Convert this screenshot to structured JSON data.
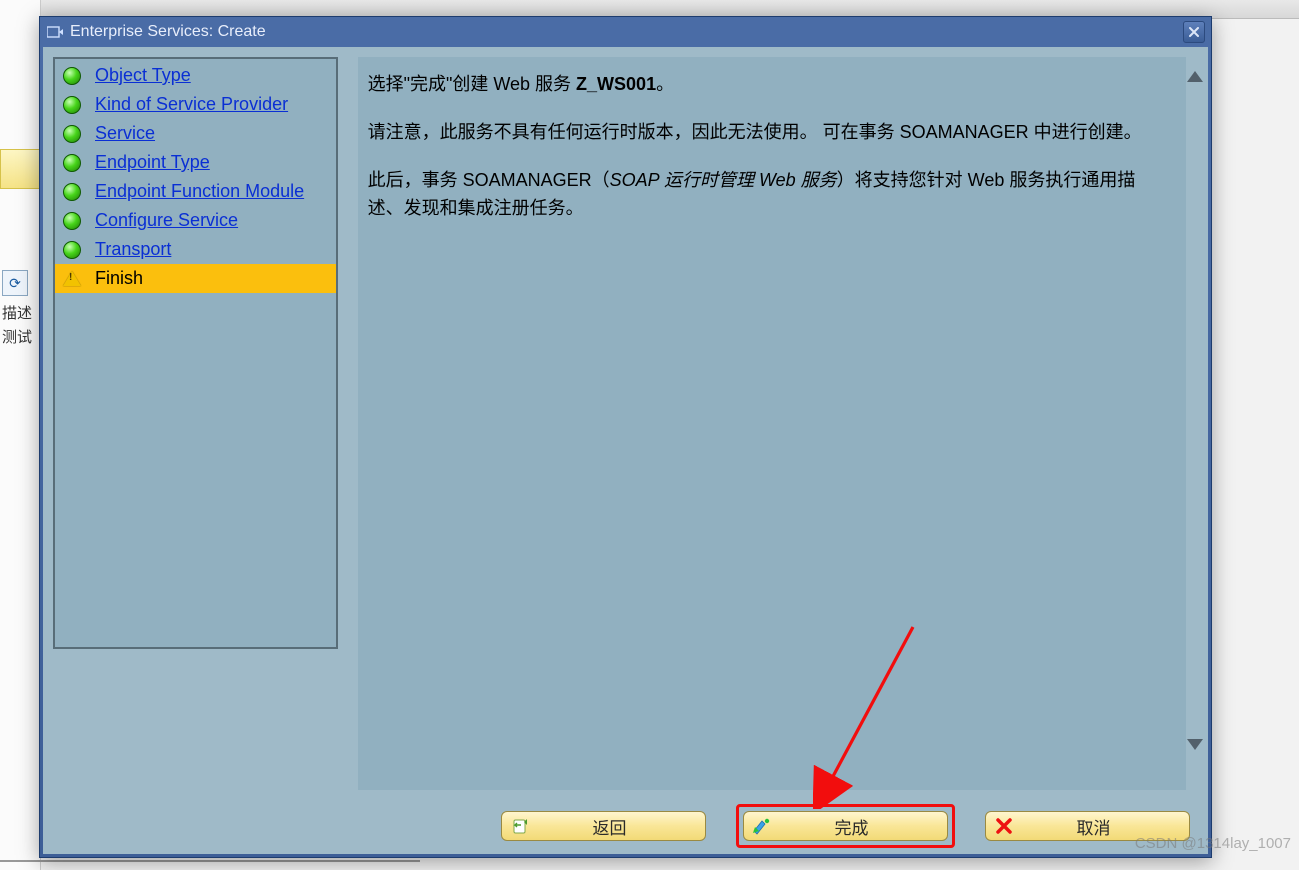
{
  "background": {
    "label1": "描述",
    "label2": "测试"
  },
  "dialog": {
    "title": "Enterprise Services: Create",
    "nav": {
      "items": [
        {
          "label": "Object Type",
          "status": "green",
          "selected": false
        },
        {
          "label": "Kind of Service Provider",
          "status": "green",
          "selected": false
        },
        {
          "label": "Service",
          "status": "green",
          "selected": false
        },
        {
          "label": "Endpoint Type",
          "status": "green",
          "selected": false
        },
        {
          "label": "Endpoint Function Module",
          "status": "green",
          "selected": false
        },
        {
          "label": "Configure Service",
          "status": "green",
          "selected": false
        },
        {
          "label": "Transport",
          "status": "green",
          "selected": false
        },
        {
          "label": "Finish",
          "status": "warn",
          "selected": true
        }
      ]
    },
    "info": {
      "p1_pre": "选择\"完成\"创建 Web 服务 ",
      "p1_ws": "Z_WS001",
      "p1_post": "。",
      "p2": "请注意，此服务不具有任何运行时版本，因此无法使用。 可在事务 SOAMANAGER 中进行创建。",
      "p3_a": "此后，事务 SOAMANAGER（",
      "p3_b": "SOAP 运行时管理 Web 服务",
      "p3_c": "）将支持您针对 Web 服务执行通用描述、发现和集成注册任务。"
    },
    "buttons": {
      "back": "返回",
      "finish": "完成",
      "cancel": "取消"
    }
  },
  "watermark": "CSDN @1314lay_1007"
}
